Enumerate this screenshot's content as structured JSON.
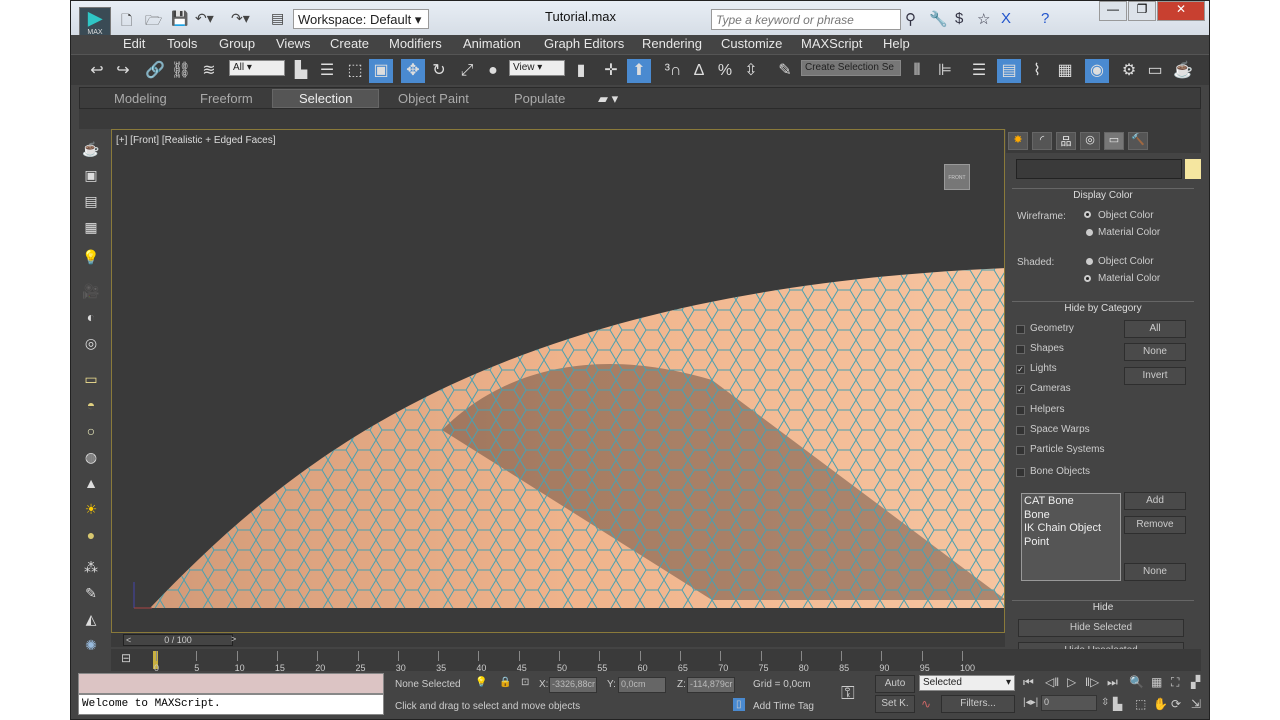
{
  "title_bar": {
    "logo": "MAX",
    "workspace": "Workspace: Default",
    "file_title": "Tutorial.max",
    "search_placeholder": "Type a keyword or phrase"
  },
  "menu": [
    "Edit",
    "Tools",
    "Group",
    "Views",
    "Create",
    "Modifiers",
    "Animation",
    "Graph Editors",
    "Rendering",
    "Customize",
    "MAXScript",
    "Help"
  ],
  "toolbar": {
    "selection_filter": "All",
    "reference_coord": "View",
    "named_selection": "Create Selection Se"
  },
  "ribbon": {
    "tabs": [
      "Modeling",
      "Freeform",
      "Selection",
      "Object Paint",
      "Populate"
    ],
    "active": "Selection"
  },
  "viewport": {
    "label": "[+] [Front] [Realistic + Edged Faces]",
    "viewcube": "FRONT",
    "mesh_color": "#f0b48c",
    "edge_color": "#4aa0b0"
  },
  "right_panel": {
    "display_color": {
      "title": "Display Color",
      "wireframe_label": "Wireframe:",
      "shaded_label": "Shaded:",
      "options": [
        "Object Color",
        "Material Color"
      ],
      "wireframe_selected": "Object Color",
      "shaded_selected": "Material Color"
    },
    "hide_by_category": {
      "title": "Hide by Category",
      "items": [
        {
          "label": "Geometry",
          "checked": false
        },
        {
          "label": "Shapes",
          "checked": false
        },
        {
          "label": "Lights",
          "checked": true
        },
        {
          "label": "Cameras",
          "checked": true
        },
        {
          "label": "Helpers",
          "checked": false
        },
        {
          "label": "Space Warps",
          "checked": false
        },
        {
          "label": "Particle Systems",
          "checked": false
        },
        {
          "label": "Bone Objects",
          "checked": false
        }
      ],
      "buttons": [
        "All",
        "None",
        "Invert"
      ],
      "list": [
        "CAT Bone",
        "Bone",
        "IK Chain Object",
        "Point"
      ],
      "list_buttons": [
        "Add",
        "Remove",
        "None"
      ]
    },
    "hide": {
      "title": "Hide",
      "buttons": [
        "Hide Selected",
        "Hide Unselected"
      ]
    }
  },
  "timeline": {
    "slider": "0 / 100",
    "ticks": [
      "0",
      "5",
      "10",
      "15",
      "20",
      "25",
      "30",
      "35",
      "40",
      "45",
      "50",
      "55",
      "60",
      "65",
      "70",
      "75",
      "80",
      "85",
      "90",
      "95",
      "100"
    ]
  },
  "status": {
    "maxscript": "Welcome to MAXScript.",
    "selection": "None Selected",
    "x_label": "X:",
    "x": "-3326,88cr",
    "y_label": "Y:",
    "y": "0,0cm",
    "z_label": "Z:",
    "z": "-114,879cr",
    "grid": "Grid = 0,0cm",
    "prompt": "Click and drag to select and move objects",
    "add_time_tag": "Add Time Tag",
    "auto": "Auto",
    "set_key": "Set K.",
    "key_filter": "Selected",
    "filters": "Filters...",
    "frame": "0"
  }
}
